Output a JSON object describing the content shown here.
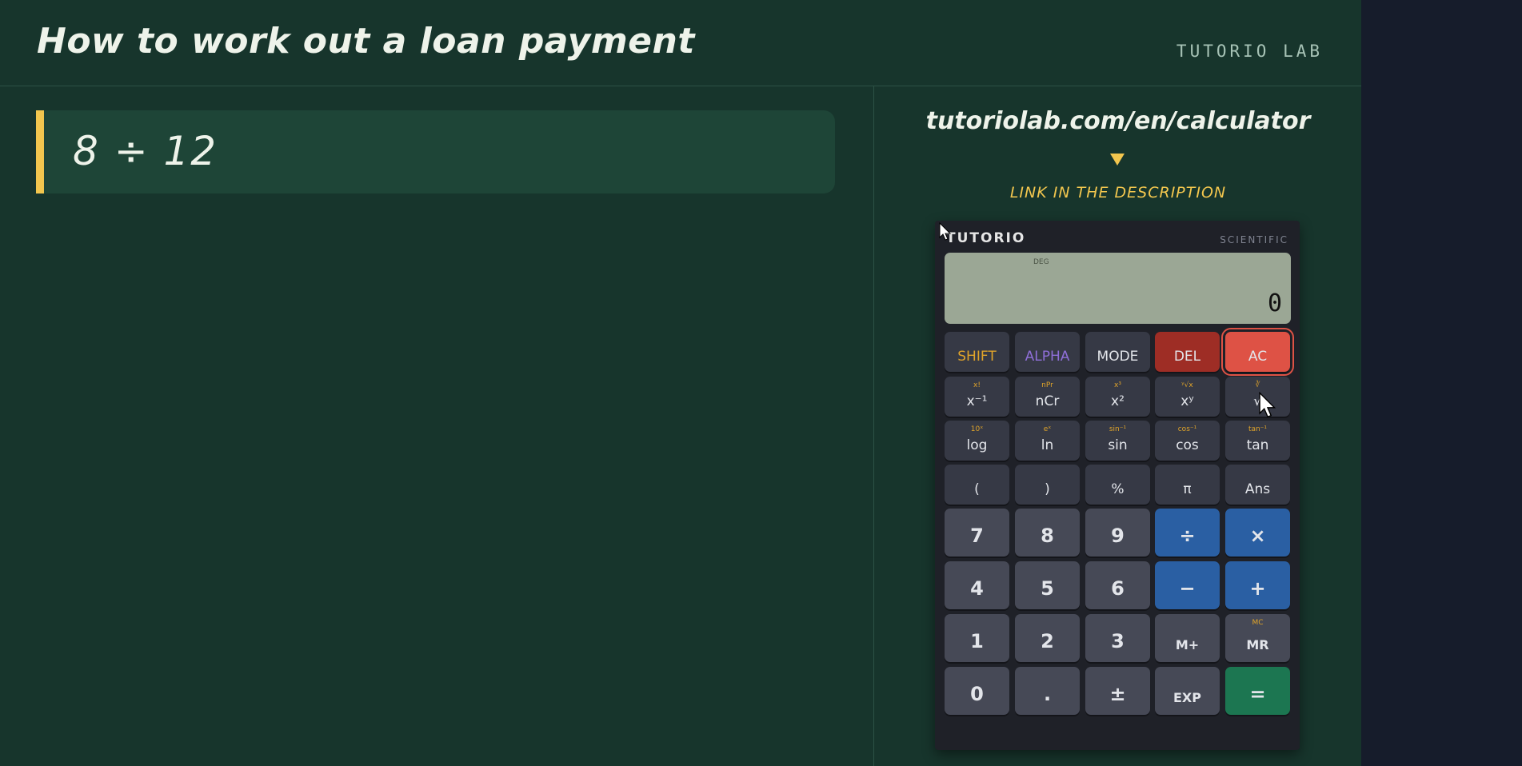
{
  "header": {
    "title": "How to work out a loan payment",
    "brand": "TUTORIO LAB"
  },
  "equation": {
    "text": "8 ÷ 12"
  },
  "promo": {
    "url": "tutoriolab.com/en/calculator",
    "note": "LINK IN THE DESCRIPTION"
  },
  "calculator": {
    "brand": "TUTORIO",
    "mode": "SCIENTIFIC",
    "angle_unit": "DEG",
    "display_value": "0",
    "rows": [
      [
        {
          "label": "SHIFT",
          "shift": ""
        },
        {
          "label": "ALPHA",
          "shift": ""
        },
        {
          "label": "MODE",
          "shift": ""
        },
        {
          "label": "DEL",
          "shift": ""
        },
        {
          "label": "AC",
          "shift": ""
        }
      ],
      [
        {
          "label": "x⁻¹",
          "shift": "x!"
        },
        {
          "label": "nCr",
          "shift": "nPr"
        },
        {
          "label": "x²",
          "shift": "x³"
        },
        {
          "label": "xʸ",
          "shift": "ʸ√x"
        },
        {
          "label": "√",
          "shift": "∛"
        }
      ],
      [
        {
          "label": "log",
          "shift": "10ˣ"
        },
        {
          "label": "ln",
          "shift": "eˣ"
        },
        {
          "label": "sin",
          "shift": "sin⁻¹"
        },
        {
          "label": "cos",
          "shift": "cos⁻¹"
        },
        {
          "label": "tan",
          "shift": "tan⁻¹"
        }
      ],
      [
        {
          "label": "(",
          "shift": ""
        },
        {
          "label": ")",
          "shift": ""
        },
        {
          "label": "%",
          "shift": ""
        },
        {
          "label": "π",
          "shift": ""
        },
        {
          "label": "Ans",
          "shift": ""
        }
      ],
      [
        {
          "label": "7",
          "shift": ""
        },
        {
          "label": "8",
          "shift": ""
        },
        {
          "label": "9",
          "shift": ""
        },
        {
          "label": "÷",
          "shift": ""
        },
        {
          "label": "×",
          "shift": ""
        }
      ],
      [
        {
          "label": "4",
          "shift": ""
        },
        {
          "label": "5",
          "shift": ""
        },
        {
          "label": "6",
          "shift": ""
        },
        {
          "label": "−",
          "shift": ""
        },
        {
          "label": "+",
          "shift": ""
        }
      ],
      [
        {
          "label": "1",
          "shift": ""
        },
        {
          "label": "2",
          "shift": ""
        },
        {
          "label": "3",
          "shift": ""
        },
        {
          "label": "M+",
          "shift": ""
        },
        {
          "label": "MR",
          "shift": "MC"
        }
      ],
      [
        {
          "label": "0",
          "shift": ""
        },
        {
          "label": ".",
          "shift": ""
        },
        {
          "label": "±",
          "shift": ""
        },
        {
          "label": "EXP",
          "shift": ""
        },
        {
          "label": "=",
          "shift": ""
        }
      ]
    ]
  },
  "colors": {
    "board": "#17352c",
    "accent": "#f2c64e",
    "sidebar": "#161c2b",
    "key_operator": "#2a5fa3",
    "key_equals": "#1c7651",
    "key_clear": "#de5245",
    "key_delete": "#9e2d25"
  },
  "icons": {
    "pointer": "mouse-pointer-icon"
  }
}
